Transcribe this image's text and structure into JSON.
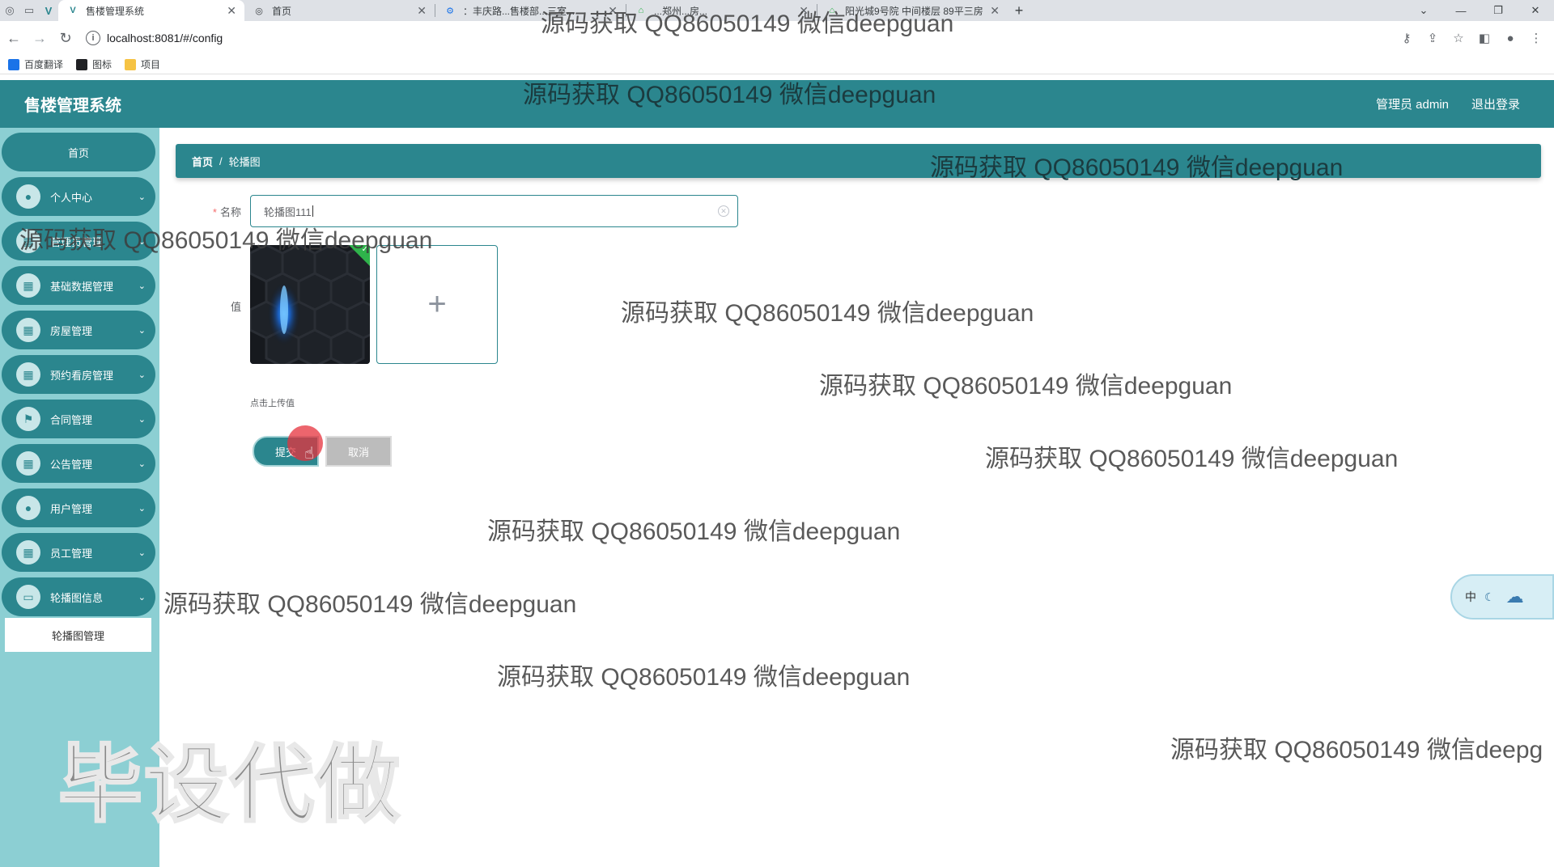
{
  "browser": {
    "tabs": [
      {
        "title": "售楼管理系统",
        "active": true
      },
      {
        "title": "首页",
        "active": false
      },
      {
        "title": "：丰庆路...售楼部...三室...",
        "active": false
      },
      {
        "title": "...郑州...房...",
        "active": false
      },
      {
        "title": "阳光城9号院 中间楼层 89平三房",
        "active": false
      }
    ],
    "url": "localhost:8081/#/config",
    "bookmarks": [
      "百度翻译",
      "图标",
      "项目"
    ]
  },
  "app": {
    "title": "售楼管理系统",
    "user": "管理员 admin",
    "logout": "退出登录"
  },
  "sidebar": {
    "items": [
      {
        "label": "首页"
      },
      {
        "label": "个人中心"
      },
      {
        "label": "管理员管理"
      },
      {
        "label": "基础数据管理"
      },
      {
        "label": "房屋管理"
      },
      {
        "label": "预约看房管理"
      },
      {
        "label": "合同管理"
      },
      {
        "label": "公告管理"
      },
      {
        "label": "用户管理"
      },
      {
        "label": "员工管理"
      },
      {
        "label": "轮播图信息"
      }
    ],
    "submenu_active": "轮播图管理"
  },
  "breadcrumb": {
    "home": "首页",
    "current": "轮播图"
  },
  "form": {
    "name_label": "名称",
    "name_value": "轮播图111",
    "value_label": "值",
    "upload_hint": "点击上传值",
    "submit": "提交",
    "cancel": "取消"
  },
  "watermarks": {
    "text": "源码获取 QQ86050149 微信deepguan",
    "text_cut": "源码获取 QQ86050149 微信deepg",
    "big": "毕设代做"
  },
  "ime": {
    "label": "中"
  }
}
